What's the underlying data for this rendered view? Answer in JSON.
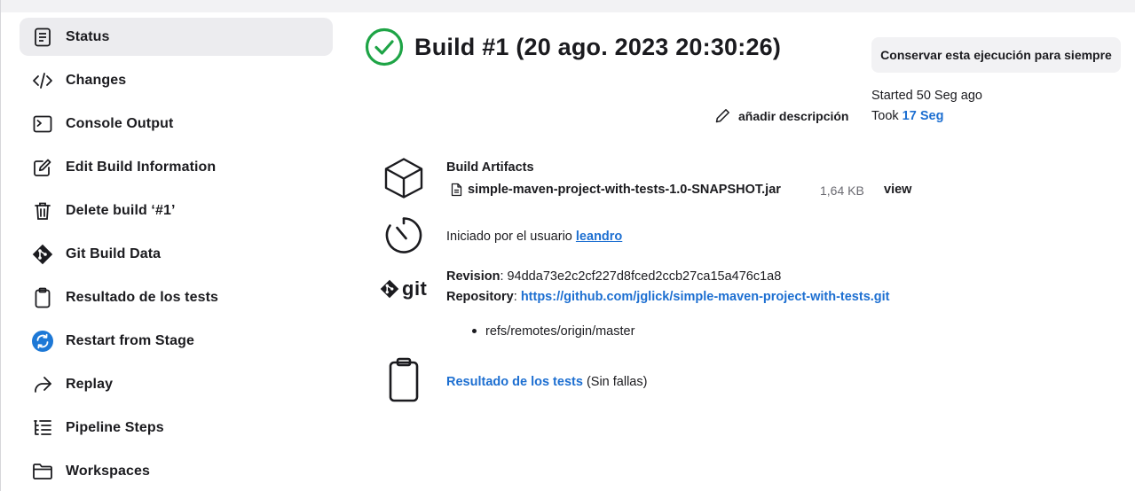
{
  "sidebar": {
    "items": [
      {
        "label": "Status",
        "icon": "document-icon",
        "active": true
      },
      {
        "label": "Changes",
        "icon": "code-icon"
      },
      {
        "label": "Console Output",
        "icon": "terminal-icon"
      },
      {
        "label": "Edit Build Information",
        "icon": "edit-icon"
      },
      {
        "label": "Delete build ‘#1’",
        "icon": "trash-icon"
      },
      {
        "label": "Git Build Data",
        "icon": "git-icon"
      },
      {
        "label": "Resultado de los tests",
        "icon": "clipboard-icon"
      },
      {
        "label": "Restart from Stage",
        "icon": "restart-icon"
      },
      {
        "label": "Replay",
        "icon": "replay-icon"
      },
      {
        "label": "Pipeline Steps",
        "icon": "steps-icon"
      },
      {
        "label": "Workspaces",
        "icon": "folder-icon"
      }
    ]
  },
  "header": {
    "title": "Build #1 (20 ago. 2023 20:30:26)",
    "keep_button": "Conservar esta ejecución para siempre",
    "add_description": "añadir descripción",
    "started": "Started 50 Seg ago",
    "took_label": "Took",
    "took_value": "17 Seg"
  },
  "artifacts": {
    "heading": "Build Artifacts",
    "file": "simple-maven-project-with-tests-1.0-SNAPSHOT.jar",
    "size": "1,64 KB",
    "view": "view"
  },
  "cause": {
    "text": "Iniciado por el usuario",
    "user": "leandro"
  },
  "git": {
    "logo_text": "git",
    "revision_label": "Revision",
    "revision_value": ": 94dda73e2c2cf227d8fced2ccb27ca15a476c1a8",
    "repository_label": "Repository",
    "repository_sep": ": ",
    "repository_url": "https://github.com/jglick/simple-maven-project-with-tests.git",
    "branch": "refs/remotes/origin/master"
  },
  "tests": {
    "link": "Resultado de los tests",
    "note": "(Sin fallas)"
  },
  "colors": {
    "link": "#1d6fd1",
    "success": "#1ea446",
    "restart": "#1d78d6",
    "sidebar_active": "#ececef"
  }
}
